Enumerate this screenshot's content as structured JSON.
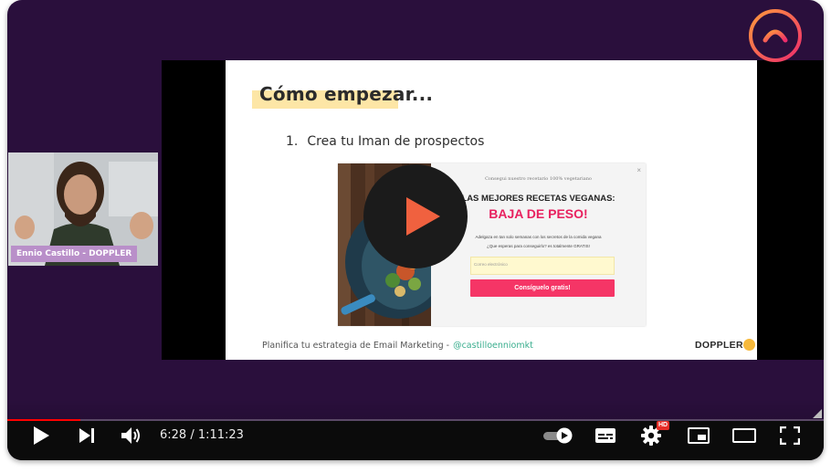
{
  "slide": {
    "title": "Cómo empezar...",
    "step_number": "1.",
    "step_text": "Crea tu Iman de prospectos",
    "footer_text": "Planifica tu estrategia de Email Marketing",
    "footer_separator": "-",
    "footer_handle": "@castilloenniomkt",
    "logo_text": "DOPPLER"
  },
  "optin": {
    "kicker": "Consegui nuestro recetario 100% vegetariano",
    "close": "×",
    "headline": "LAS MEJORES RECETAS VEGANAS:",
    "headline2": "BAJA DE PESO!",
    "desc1": "Adelgaza en tan solo semanas con los secretos de la comida vegana",
    "desc2": "¿Que esperas para conseguirlo? es totalmente GRATIS!",
    "email_placeholder": "Correo electrónico",
    "cta_label": "Consíguelo gratis!"
  },
  "webcam": {
    "presenter_label": "Ennio Castillo - DOPPLER"
  },
  "controls": {
    "time_display": "6:28 / 1:11:23",
    "hd_badge": "HD",
    "progress_fraction": 0.09
  },
  "colors": {
    "player_bg": "#2a0f3c",
    "accent_pink": "#e8215f",
    "brand_orange": "#f36a3a",
    "handle_green": "#3aae8e"
  },
  "icons": {
    "brand": "doppler-logo-icon",
    "play": "play-icon",
    "next": "next-icon",
    "volume": "volume-icon",
    "autoplay": "autoplay-toggle-icon",
    "captions": "captions-icon",
    "settings": "gear-icon",
    "miniplayer": "miniplayer-icon",
    "theater": "theater-mode-icon",
    "fullscreen": "fullscreen-icon"
  }
}
